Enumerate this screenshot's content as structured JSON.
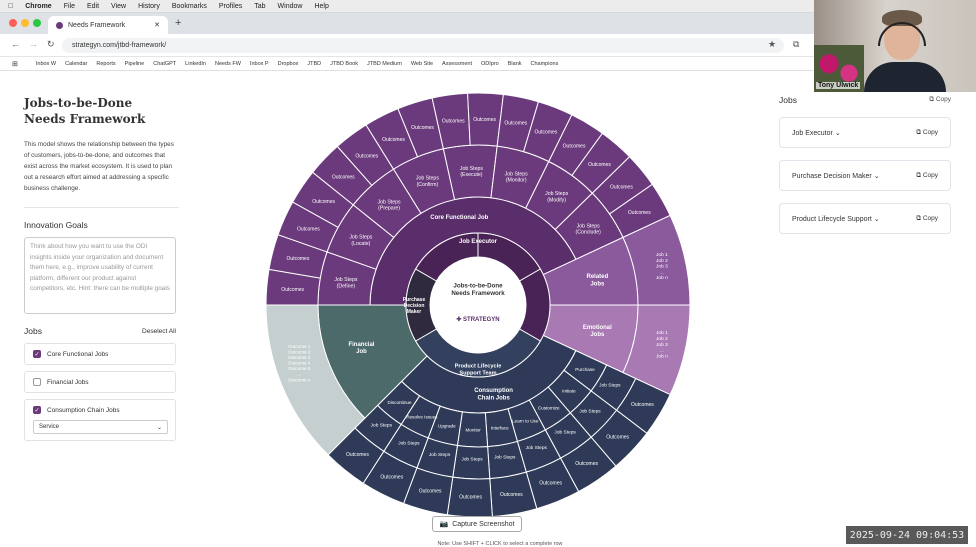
{
  "menubar": {
    "items": [
      "Chrome",
      "File",
      "Edit",
      "View",
      "History",
      "Bookmarks",
      "Profiles",
      "Tab",
      "Window",
      "Help"
    ]
  },
  "tab": {
    "title": "Needs Framework",
    "new_tab": "+"
  },
  "address": {
    "url": "strategyn.com/jtbd-framework/"
  },
  "bookmarks": [
    "Inbox W",
    "Calendar",
    "Reports",
    "Pipeline",
    "ChatGPT",
    "LinkedIn",
    "Needs FW",
    "Inbox P",
    "Dropbox",
    "JTBD",
    "JTBD Book",
    "JTBD Medium",
    "Web Site",
    "Assessment",
    "ODIpro",
    "Blank",
    "Champions"
  ],
  "video": {
    "name": "Tony Ulwick"
  },
  "left": {
    "title_line1": "Jobs-to-be-Done",
    "title_line2": "Needs Framework",
    "description": "This model shows the relationship between the types of customers, jobs-to-be-done, and outcomes that exist across the market ecosystem. It is used to plan out a research effort aimed at addressing a specific business challenge.",
    "innovation_goals": "Innovation Goals",
    "goals_placeholder": "Think about how you want to use the ODI insights inside your organization and document them here, e.g., improve usability of current platform, different our product against competitors, etc. Hint: there can be multiple goals",
    "jobs_label": "Jobs",
    "deselect_all": "Deselect All",
    "job_items": [
      {
        "label": "Core Functional Jobs",
        "checked": true
      },
      {
        "label": "Financial Jobs",
        "checked": false
      },
      {
        "label": "Consumption Chain Jobs",
        "checked": true
      }
    ],
    "service_select": "Service"
  },
  "right": {
    "title": "Jobs",
    "copy": "Copy",
    "items": [
      {
        "label": "Job Executor",
        "copy": "Copy"
      },
      {
        "label": "Purchase Decision Maker",
        "copy": "Copy"
      },
      {
        "label": "Product Lifecycle Support",
        "copy": "Copy"
      }
    ]
  },
  "wheel": {
    "center_line1": "Jobs-to-be-Done",
    "center_line2": "Needs Framework",
    "logo": "STRATEGYN",
    "executor": "Job Executor",
    "purchase_lines": [
      "Purchase",
      "Decision",
      "Maker"
    ],
    "support_lines": [
      "Product Lifecycle",
      "Support Team"
    ],
    "core": "Core Functional Job",
    "related_lines": [
      "Related",
      "Jobs"
    ],
    "emotional_lines": [
      "Emotional",
      "Jobs"
    ],
    "financial_lines": [
      "Financial",
      "Job"
    ],
    "consumption_lines": [
      "Consumption",
      "Chain Jobs"
    ],
    "core_steps": [
      [
        "Job Steps",
        "(Define)"
      ],
      [
        "Job Steps",
        "(Locate)"
      ],
      [
        "Job Steps",
        "(Prepare)"
      ],
      [
        "Job Steps",
        "(Confirm)"
      ],
      [
        "Job Steps",
        "(Execute)"
      ],
      [
        "Job Steps",
        "(Monitor)"
      ],
      [
        "Job Steps",
        "(Modify)"
      ],
      [
        "Job Steps",
        "(Conclude)"
      ]
    ],
    "outcomes": "Outcomes",
    "related_list": [
      "Job 1",
      "Job 2",
      "Job 3",
      "...",
      "Job n"
    ],
    "emotional_list": [
      "Job 1",
      "Job 2",
      "Job 3",
      "...",
      "Job n"
    ],
    "financial_list": [
      "Outcome 1",
      "Outcome 2",
      "Outcome 3",
      "Outcome 4",
      "Outcome 5",
      "...",
      "Outcome n"
    ],
    "chain_items": [
      "Purchase",
      "Initiate",
      "Customize",
      "Learn to Use",
      "Interface",
      "Monitor",
      "Upgrade",
      "Resolve Issues",
      "Discontinue"
    ],
    "job_steps": "Job Steps"
  },
  "capture": "Capture Screenshot",
  "note": "Note: Use SHIFT + CLICK to select a complete row",
  "clock": "2025-09-24 09:04:53",
  "colors": {
    "core": "#6b3a7c",
    "core_dark": "#5a2e6b",
    "related": "#8b5a9c",
    "emotional": "#a979b3",
    "executor": "#4a2356",
    "financial": "#4d6a6b",
    "financial_light": "#c6cfd0",
    "consumption": "#2e3a57",
    "purchase": "#2f2a3e",
    "support": "#33405e",
    "edge": "#ffffff"
  }
}
